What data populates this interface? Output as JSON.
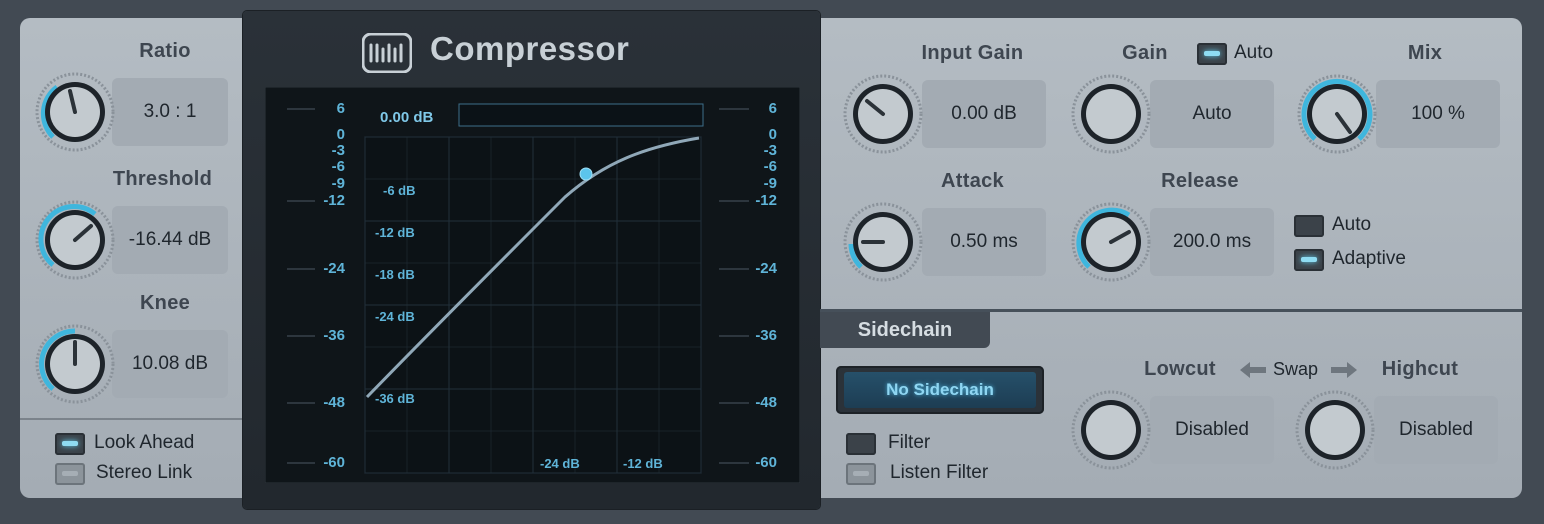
{
  "title": "Compressor",
  "left": {
    "ratio": {
      "label": "Ratio",
      "value": "3.0 : 1"
    },
    "threshold": {
      "label": "Threshold",
      "value": "-16.44 dB"
    },
    "knee": {
      "label": "Knee",
      "value": "10.08 dB"
    },
    "look_ahead": {
      "label": "Look Ahead",
      "on": true
    },
    "stereo_link": {
      "label": "Stereo Link",
      "on": false
    }
  },
  "graph": {
    "readout": "0.00 dB",
    "left_scale": [
      "6",
      "0",
      "-3",
      "-6",
      "-9",
      "-12",
      "-24",
      "-36",
      "-48",
      "-60"
    ],
    "right_scale": [
      "6",
      "0",
      "-3",
      "-6",
      "-9",
      "-12",
      "-24",
      "-36",
      "-48",
      "-60"
    ],
    "inner_y_labels": [
      "-6 dB",
      "-12 dB",
      "-18 dB",
      "-24 dB",
      "-36 dB"
    ],
    "inner_x_labels": [
      "-24 dB",
      "-12 dB"
    ]
  },
  "right": {
    "input_gain": {
      "label": "Input Gain",
      "value": "0.00 dB"
    },
    "gain": {
      "label": "Gain",
      "value": "Auto",
      "auto_label": "Auto",
      "auto_on": true
    },
    "mix": {
      "label": "Mix",
      "value": "100 %"
    },
    "attack": {
      "label": "Attack",
      "value": "0.50 ms"
    },
    "release": {
      "label": "Release",
      "value": "200.0 ms"
    },
    "release_auto": {
      "label": "Auto",
      "on": false
    },
    "adaptive": {
      "label": "Adaptive",
      "on": true
    }
  },
  "sidechain": {
    "tab_label": "Sidechain",
    "source": "No Sidechain",
    "filter": {
      "label": "Filter",
      "on": false
    },
    "listen_filter": {
      "label": "Listen Filter",
      "on": false
    },
    "lowcut": {
      "label": "Lowcut",
      "value": "Disabled"
    },
    "swap_label": "Swap",
    "highcut": {
      "label": "Highcut",
      "value": "Disabled"
    }
  },
  "colors": {
    "accent": "#3fb6dd",
    "panel": "#a9b1b9",
    "dark": "#1b2329"
  }
}
